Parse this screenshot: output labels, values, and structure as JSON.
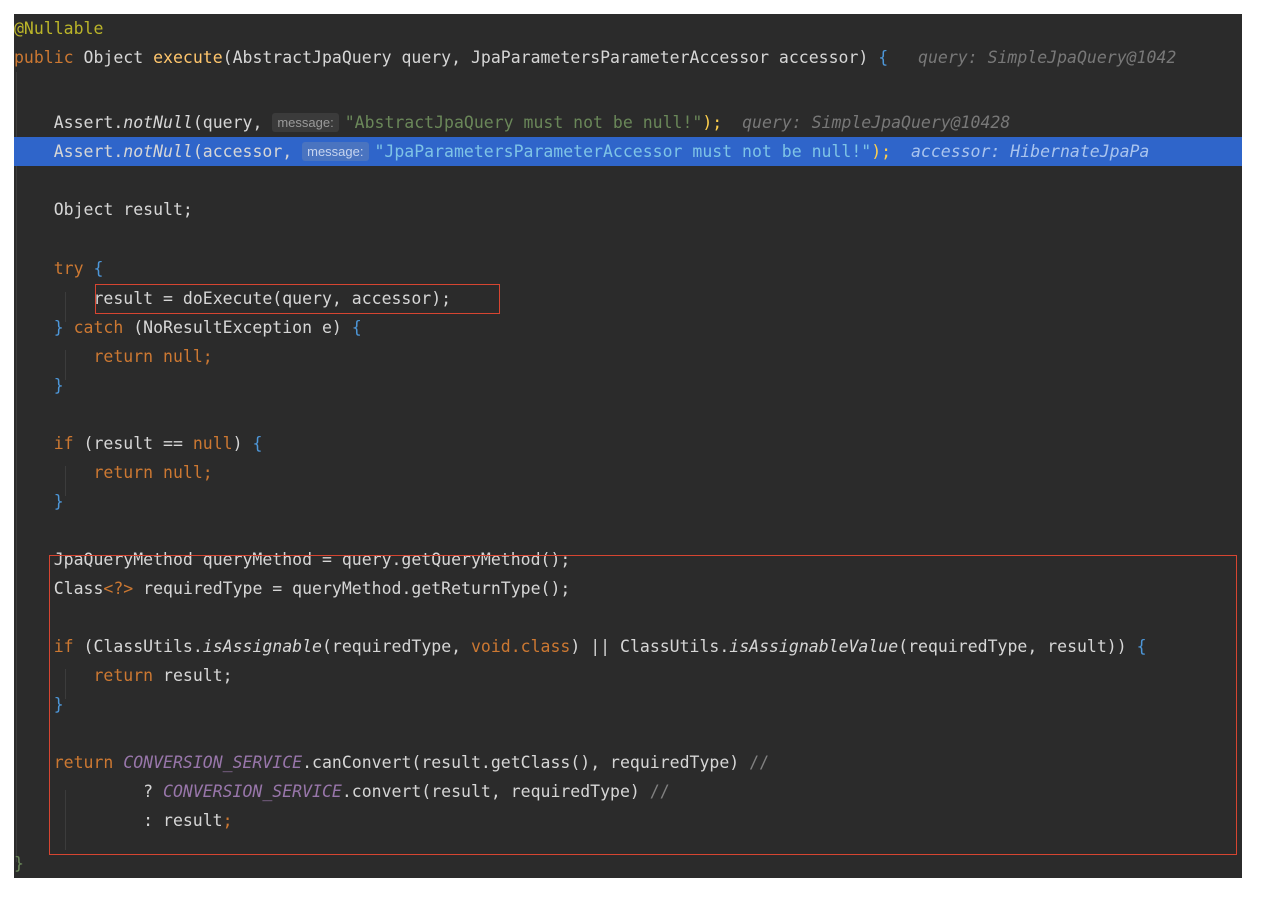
{
  "editor": {
    "annotation": "@Nullable",
    "signature": {
      "kw_public": "public",
      "ret_type": " Object ",
      "method": "execute",
      "params": "(AbstractJpaQuery query, JpaParametersParameterAccessor accessor)",
      "brace": " {",
      "debug": "query: SimpleJpaQuery@1042"
    },
    "assert1": {
      "prefix": "Assert.",
      "method": "notNull",
      "args": "(query, ",
      "hint": "message:",
      "string": "\"AbstractJpaQuery must not be null!\"",
      "end": ");",
      "debug": "query: SimpleJpaQuery@10428"
    },
    "assert2": {
      "prefix": "Assert.",
      "method": "notNull",
      "args": "(accessor, ",
      "hint": "message:",
      "string": "\"JpaParametersParameterAccessor must not be null!\"",
      "end": ");",
      "debug": "accessor: HibernateJpaPa"
    },
    "decl": "Object result;",
    "try_kw": "try",
    "try_brace": " {",
    "do_execute": "result = doExecute(query, accessor);",
    "catch_close": "} ",
    "catch_kw": "catch",
    "catch_args": " (NoResultException e) ",
    "catch_brace": "{",
    "return_kw": "return",
    "null_kw": "null",
    "semicolon": ";",
    "close_brace": "}",
    "if_kw": "if",
    "if_cond": " (result == ",
    "if_cond_end": ") ",
    "query_method_line": "JpaQueryMethod queryMethod = query.getQueryMethod();",
    "class_type": "Class",
    "class_generic": "<?>",
    "required_type_line": " requiredType = queryMethod.getReturnType();",
    "if2_part1": " (ClassUtils.",
    "is_assignable": "isAssignable",
    "if2_part2": "(requiredType, ",
    "void_class": "void.class",
    "if2_part3": ") || ClassUtils.",
    "is_assignable_value": "isAssignableValue",
    "if2_part4": "(requiredType, result)) ",
    "return_result": " result;",
    "conversion_service": "CONVERSION_SERVICE",
    "can_convert": ".canConvert(result.getClass(), requiredType) ",
    "comment": "//",
    "ternary_q": "? ",
    "convert": ".convert(result, requiredType) ",
    "ternary_colon": ": result",
    "method_close": "}"
  }
}
